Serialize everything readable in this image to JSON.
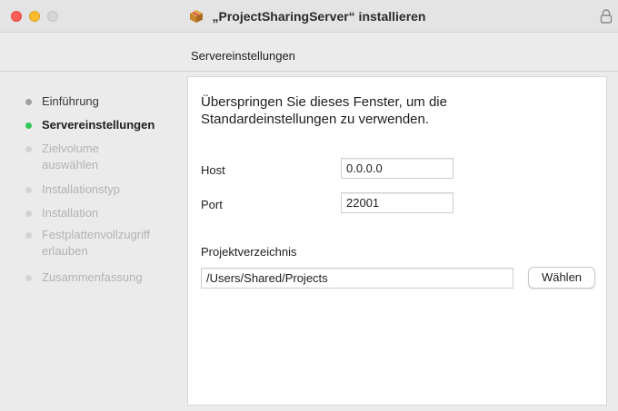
{
  "window": {
    "title": "„ProjectSharingServer“ installieren",
    "icons": [
      "close-icon",
      "minimize-icon",
      "zoom-icon",
      "package-icon",
      "lock-icon"
    ]
  },
  "step_heading": "Servereinstellungen",
  "steps": [
    {
      "label": "Einführung",
      "state": "done"
    },
    {
      "label": "Servereinstellungen",
      "state": "active"
    },
    {
      "label": "Zielvolume auswählen",
      "state": "todo"
    },
    {
      "label": "Installationstyp",
      "state": "todo"
    },
    {
      "label": "Installation",
      "state": "todo"
    },
    {
      "label": "Festplattenvollzugriff erlauben",
      "state": "todo"
    },
    {
      "label": "Zusammenfassung",
      "state": "todo"
    }
  ],
  "panel": {
    "intro": "Überspringen Sie dieses Fenster, um die Standardeinstellungen zu verwenden.",
    "host_label": "Host",
    "host_value": "0.0.0.0",
    "port_label": "Port",
    "port_value": "22001",
    "dir_label": "Projektverzeichnis",
    "dir_value": "/Users/Shared/Projects",
    "choose_label": "Wählen"
  },
  "colors": {
    "active_dot": "#35c759",
    "close": "#ff5f57",
    "minimize": "#febc2e"
  }
}
